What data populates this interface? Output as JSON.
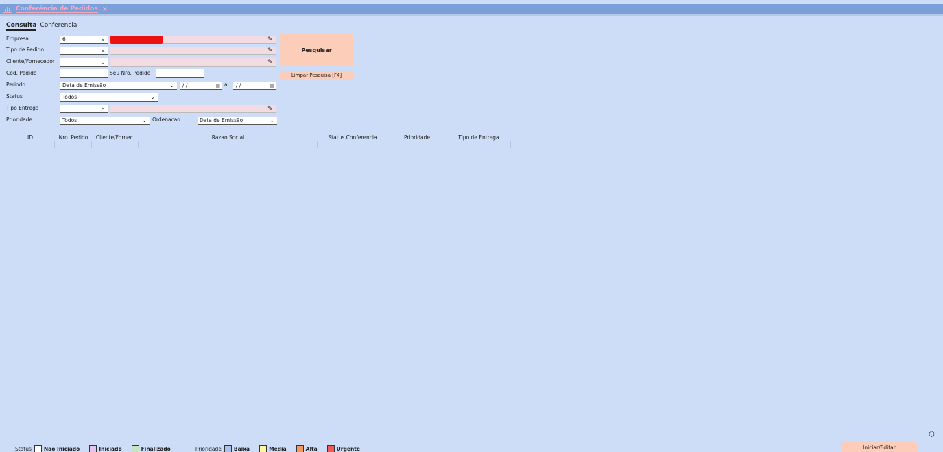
{
  "window": {
    "tab_title": "Conferência de Pedidos",
    "close": "×",
    "icon": "bar-chart-icon"
  },
  "subtabs": [
    "Consulta",
    "Conferencia"
  ],
  "form": {
    "empresa_label": "Empresa",
    "empresa_value": "6",
    "tipo_pedido_label": "Tipo de Pedido",
    "cliente_label": "Cliente/Fornecedor",
    "cod_pedido_label": "Cod. Pedido",
    "seu_nro_label": "Seu Nro. Pedido",
    "periodo_label": "Periodo",
    "periodo_value": "Data de Emissão",
    "date_from": "/ /",
    "date_sep": "a",
    "date_to": "/ /",
    "status_label": "Status",
    "status_value": "Todos",
    "tipo_entrega_label": "Tipo Entrega",
    "prioridade_label": "Prioridade",
    "prioridade_value": "Todos",
    "ordenacao_label": "Ordenacao",
    "ordenacao_value": "Data de Emissão"
  },
  "buttons": {
    "pesquisar": "Pesquisar",
    "limpar": "Limpar Pesquisa [F4]",
    "iniciar": "Iniciar/Editar"
  },
  "table": {
    "columns": [
      "ID",
      "Nro. Pedido",
      "Cliente/Fornec.",
      "Razao Social",
      "Status Conferencia",
      "Prioridade",
      "Tipo de Entrega"
    ]
  },
  "legend": {
    "status_caption": "Status",
    "status_items": [
      {
        "label": "Nao Iniciado",
        "color": "#ffffff"
      },
      {
        "label": "Iniciado",
        "color": "#e2c6ee"
      },
      {
        "label": "Finalizado",
        "color": "#c6e5c6"
      }
    ],
    "prioridade_caption": "Prioridade",
    "prioridade_items": [
      {
        "label": "Baixa",
        "color": "#a8c4ee"
      },
      {
        "label": "Media",
        "color": "#fdf5a0"
      },
      {
        "label": "Alta",
        "color": "#f49a5e"
      },
      {
        "label": "Urgente",
        "color": "#f05a5a"
      }
    ]
  },
  "colors": {
    "background": "#cdddf7",
    "titlebar": "#7b9fd9",
    "button": "#fccdb8",
    "tab_accent": "#f7a8c0",
    "redacted": "#ee1111"
  }
}
